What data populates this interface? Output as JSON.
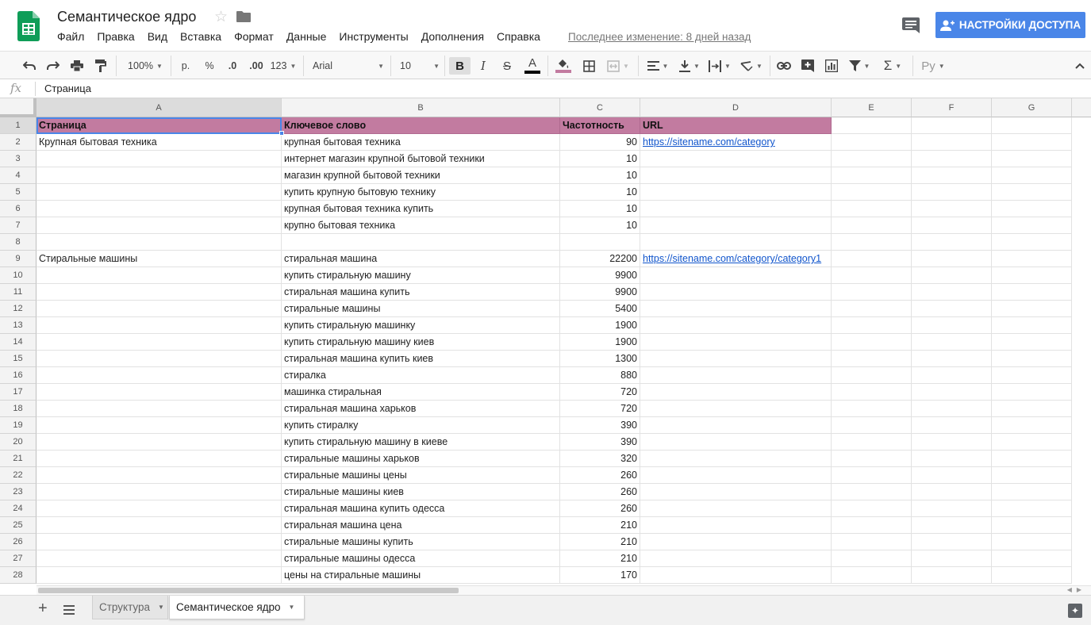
{
  "header": {
    "title": "Семантическое ядро",
    "menu": [
      "Файл",
      "Правка",
      "Вид",
      "Вставка",
      "Формат",
      "Данные",
      "Инструменты",
      "Дополнения",
      "Справка"
    ],
    "last_edit": "Последнее изменение: 8 дней назад",
    "share_label": "НАСТРОЙКИ ДОСТУПА",
    "colors": {
      "share_button": "#4a86e8",
      "logo": "#0f9d58"
    }
  },
  "toolbar": {
    "zoom": "100%",
    "currency": "р.",
    "percent": "%",
    "dec_decrease": ".0",
    "dec_increase": ".00",
    "more_formats": "123",
    "font": "Arial",
    "font_size": "10",
    "bold": "B",
    "italic": "I",
    "strike": "S",
    "text_color": "A",
    "input_tools": "Ру"
  },
  "formula_bar": {
    "fx": "fx",
    "value": "Страница"
  },
  "grid": {
    "columns": [
      "A",
      "B",
      "C",
      "D",
      "E",
      "F",
      "G"
    ],
    "header_color": "#c27ba0",
    "header_row": [
      "Страница",
      "Ключевое слово",
      "Частотность",
      "URL"
    ],
    "rows": [
      [
        "2",
        "Крупная бытовая техника",
        "крупная бытовая техника",
        "90",
        "https://sitename.com/category"
      ],
      [
        "3",
        "",
        "интернет магазин крупной бытовой техники",
        "10",
        ""
      ],
      [
        "4",
        "",
        "магазин крупной бытовой техники",
        "10",
        ""
      ],
      [
        "5",
        "",
        "купить крупную бытовую технику",
        "10",
        ""
      ],
      [
        "6",
        "",
        "крупная бытовая техника купить",
        "10",
        ""
      ],
      [
        "7",
        "",
        "крупно бытовая техника",
        "10",
        ""
      ],
      [
        "8",
        "",
        "",
        "",
        ""
      ],
      [
        "9",
        "Стиральные машины",
        "стиральная машина",
        "22200",
        "https://sitename.com/category/category1"
      ],
      [
        "10",
        "",
        "купить стиральную машину",
        "9900",
        ""
      ],
      [
        "11",
        "",
        "стиральная машина купить",
        "9900",
        ""
      ],
      [
        "12",
        "",
        "стиральные машины",
        "5400",
        ""
      ],
      [
        "13",
        "",
        "купить стиральную машинку",
        "1900",
        ""
      ],
      [
        "14",
        "",
        "купить стиральную машину киев",
        "1900",
        ""
      ],
      [
        "15",
        "",
        "стиральная машина купить киев",
        "1300",
        ""
      ],
      [
        "16",
        "",
        "стиралка",
        "880",
        ""
      ],
      [
        "17",
        "",
        "машинка стиральная",
        "720",
        ""
      ],
      [
        "18",
        "",
        "стиральная машина харьков",
        "720",
        ""
      ],
      [
        "19",
        "",
        "купить стиралку",
        "390",
        ""
      ],
      [
        "20",
        "",
        "купить стиральную машину в киеве",
        "390",
        ""
      ],
      [
        "21",
        "",
        "стиральные машины харьков",
        "320",
        ""
      ],
      [
        "22",
        "",
        "стиральные машины цены",
        "260",
        ""
      ],
      [
        "23",
        "",
        "стиральные машины киев",
        "260",
        ""
      ],
      [
        "24",
        "",
        "стиральная машина купить одесса",
        "260",
        ""
      ],
      [
        "25",
        "",
        "стиральная машина цена",
        "210",
        ""
      ],
      [
        "26",
        "",
        "стиральные машины купить",
        "210",
        ""
      ],
      [
        "27",
        "",
        "стиральные машины одесса",
        "210",
        ""
      ],
      [
        "28",
        "",
        "цены на стиральные машины",
        "170",
        ""
      ]
    ]
  },
  "sheets": {
    "tabs": [
      "Структура",
      "Семантическое ядро"
    ],
    "active": "Семантическое ядро"
  }
}
